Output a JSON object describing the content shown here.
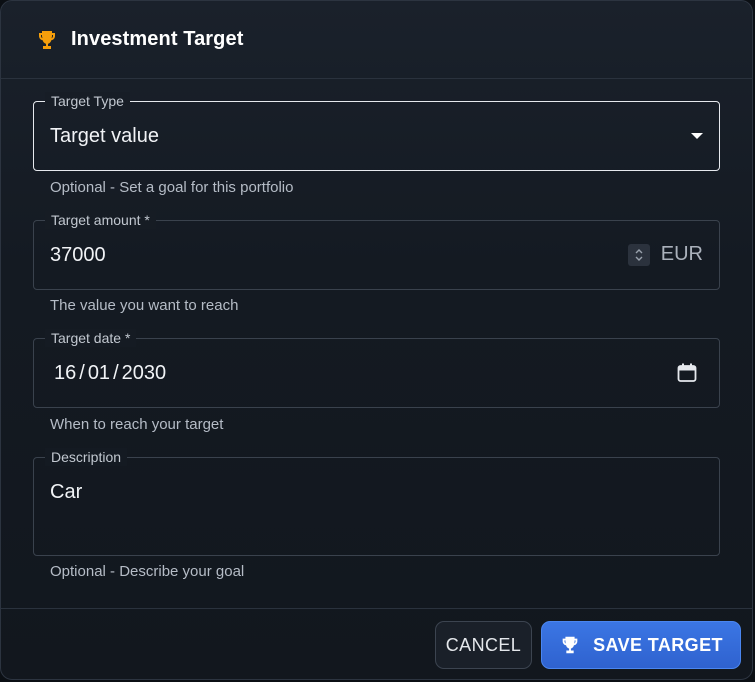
{
  "dialog": {
    "title": "Investment Target",
    "title_icon": "trophy-icon"
  },
  "fields": {
    "target_type": {
      "label": "Target Type",
      "value": "Target value",
      "helper": "Optional - Set a goal for this portfolio"
    },
    "target_amount": {
      "label": "Target amount *",
      "value": "37000",
      "currency": "EUR",
      "helper": "The value you want to reach"
    },
    "target_date": {
      "label": "Target date *",
      "day": "16",
      "month": "01",
      "year": "2030",
      "separator": "/",
      "helper": "When to reach your target"
    },
    "description": {
      "label": "Description",
      "value": "Car",
      "helper": "Optional - Describe your goal"
    }
  },
  "footer": {
    "cancel_label": "CANCEL",
    "save_label": "SAVE TARGET",
    "save_icon": "trophy-icon"
  },
  "colors": {
    "accent_icon": "#f59e0b",
    "primary_button": "#3169d8",
    "background": "#151b23"
  }
}
